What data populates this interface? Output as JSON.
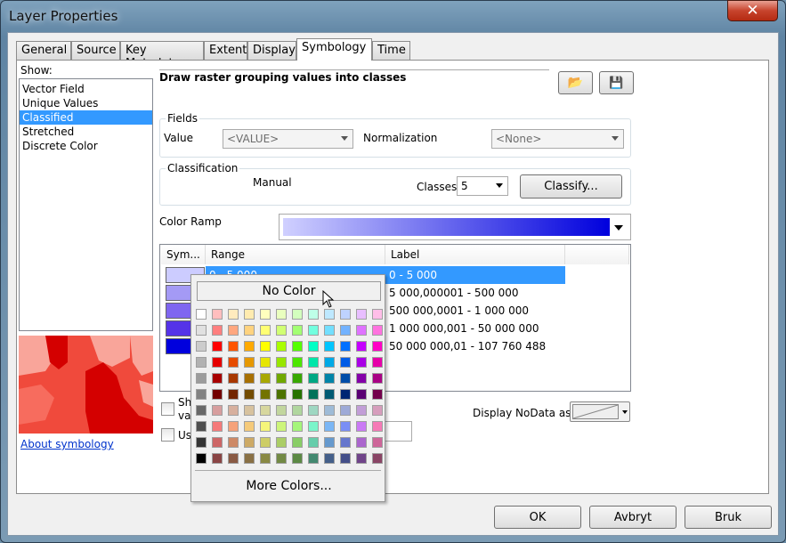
{
  "window": {
    "title": "Layer Properties",
    "close_icon": "close-icon"
  },
  "tabs": [
    {
      "label": "General"
    },
    {
      "label": "Source"
    },
    {
      "label": "Key Metadata"
    },
    {
      "label": "Extent"
    },
    {
      "label": "Display"
    },
    {
      "label": "Symbology",
      "active": true
    },
    {
      "label": "Time"
    }
  ],
  "show": {
    "label": "Show:",
    "items": [
      {
        "label": "Vector Field"
      },
      {
        "label": "Unique Values"
      },
      {
        "label": "Classified",
        "selected": true
      },
      {
        "label": "Stretched"
      },
      {
        "label": "Discrete Color"
      }
    ]
  },
  "about_link": "About symbology",
  "heading": "Draw raster grouping values into classes",
  "fields": {
    "title": "Fields",
    "value_label": "Value",
    "value": "<VALUE>",
    "normalization_label": "Normalization",
    "normalization": "<None>"
  },
  "classification": {
    "title": "Classification",
    "method": "Manual",
    "classes_label": "Classes",
    "classes": "5",
    "classify_button": "Classify..."
  },
  "color_ramp": {
    "label": "Color Ramp",
    "start": "#d0d0ff",
    "end": "#0000dd"
  },
  "table": {
    "headers": [
      "Sym...",
      "Range",
      "Label"
    ],
    "rows": [
      {
        "color": "#ccccff",
        "range": "0 - 5 000",
        "label": "0 - 5 000"
      },
      {
        "color": "#a49af5",
        "range": "5 000,000001 - 500 000",
        "label": "5 000,000001 - 500 000"
      },
      {
        "color": "#7f66f0",
        "range": "500 000,0001 - 1 000 000",
        "label": "500 000,0001 - 1 000 000"
      },
      {
        "color": "#5533e8",
        "range": "1 000 000,001 - 50 000 000",
        "label": "1 000 000,001 - 50 000 000"
      },
      {
        "color": "#0000dd",
        "range": "50 000 000,01 - 107 760 488",
        "label": "50 000 000,01 - 107 760 488"
      }
    ]
  },
  "options": {
    "show_class_partial": "Sh",
    "show_class_partial2": "va",
    "use_partial": "Us",
    "nodata_label": "Display NoData as"
  },
  "popup": {
    "no_color": "No Color",
    "more_colors": "More Colors...",
    "palette": [
      [
        "#ffffff",
        "#ffbebe",
        "#ffebbe",
        "#ffebaf",
        "#ffffbe",
        "#e9ffbe",
        "#d3ffbe",
        "#beffe8",
        "#bee8ff",
        "#bed2ff",
        "#e8beff",
        "#ffbee8"
      ],
      [
        "#e1e1e1",
        "#ff7f7f",
        "#ffa77f",
        "#ffd37f",
        "#ffff73",
        "#d1ff73",
        "#a3ff73",
        "#73ffdf",
        "#73dfff",
        "#73b2ff",
        "#df73ff",
        "#ff73df"
      ],
      [
        "#cccccc",
        "#ff0000",
        "#ff5500",
        "#ffaa00",
        "#ffff00",
        "#aaff00",
        "#55ff00",
        "#00ffc5",
        "#00c5ff",
        "#0070ff",
        "#c500ff",
        "#ff00c5"
      ],
      [
        "#b2b2b2",
        "#e60000",
        "#e64c00",
        "#e69800",
        "#e6e600",
        "#98e600",
        "#4ce600",
        "#00e6a9",
        "#00a9e6",
        "#005ce6",
        "#a900e6",
        "#e600a9"
      ],
      [
        "#9c9c9c",
        "#a80000",
        "#a83800",
        "#a87000",
        "#a8a800",
        "#70a800",
        "#38a800",
        "#00a884",
        "#0084a8",
        "#004da8",
        "#8400a8",
        "#a80084"
      ],
      [
        "#828282",
        "#730000",
        "#732600",
        "#734c00",
        "#737300",
        "#4c7300",
        "#267300",
        "#00735a",
        "#005a73",
        "#002673",
        "#5a0073",
        "#73004c"
      ],
      [
        "#686868",
        "#d79e9e",
        "#d7b09e",
        "#d7c29e",
        "#d7d79e",
        "#c2d69e",
        "#b0d69e",
        "#9ed7c2",
        "#9ebbd7",
        "#9eaad7",
        "#c29ed7",
        "#d69dbc"
      ],
      [
        "#4e4e4e",
        "#f57a7a",
        "#f5a27a",
        "#f5ca7a",
        "#f5f57a",
        "#cdf57a",
        "#a5f57a",
        "#7af5ca",
        "#7ab6f5",
        "#7a8ef5",
        "#ca7af5",
        "#f57ab6"
      ],
      [
        "#343434",
        "#cd6666",
        "#cd8966",
        "#cdaa66",
        "#cdcd66",
        "#abcd66",
        "#89cd66",
        "#66cdab",
        "#6699cd",
        "#6677cd",
        "#ab66cd",
        "#cd6699"
      ],
      [
        "#000000",
        "#894444",
        "#895a44",
        "#897044",
        "#898944",
        "#728944",
        "#5c8944",
        "#448970",
        "#445f89",
        "#444f89",
        "#704489",
        "#894465"
      ]
    ]
  },
  "buttons": {
    "ok": "OK",
    "cancel": "Avbryt",
    "apply": "Bruk"
  }
}
